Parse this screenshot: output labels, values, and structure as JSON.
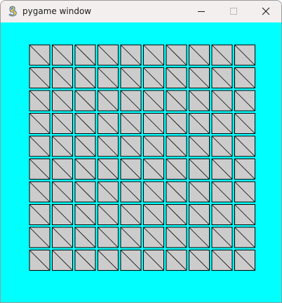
{
  "window": {
    "title": "pygame window",
    "icon": "pygame-snake-icon",
    "controls": [
      "minimize-icon",
      "maximize-icon",
      "close-icon"
    ]
  },
  "game": {
    "background_color": "#00ffff",
    "grid_rows": 10,
    "grid_cols": 10,
    "tile_color": "#cccccc",
    "tile_border_color": "#000000",
    "tile_icon": "diagonal-line-icon"
  }
}
